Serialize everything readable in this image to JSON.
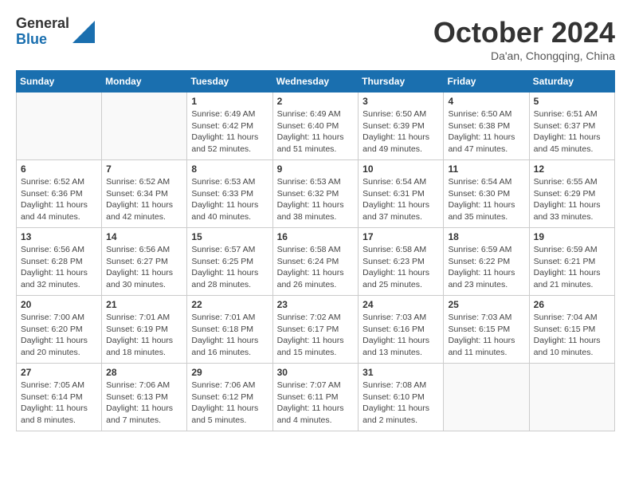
{
  "header": {
    "logo_general": "General",
    "logo_blue": "Blue",
    "month_title": "October 2024",
    "location": "Da'an, Chongqing, China"
  },
  "days_of_week": [
    "Sunday",
    "Monday",
    "Tuesday",
    "Wednesday",
    "Thursday",
    "Friday",
    "Saturday"
  ],
  "weeks": [
    [
      {
        "day": "",
        "info": ""
      },
      {
        "day": "",
        "info": ""
      },
      {
        "day": "1",
        "info": "Sunrise: 6:49 AM\nSunset: 6:42 PM\nDaylight: 11 hours and 52 minutes."
      },
      {
        "day": "2",
        "info": "Sunrise: 6:49 AM\nSunset: 6:40 PM\nDaylight: 11 hours and 51 minutes."
      },
      {
        "day": "3",
        "info": "Sunrise: 6:50 AM\nSunset: 6:39 PM\nDaylight: 11 hours and 49 minutes."
      },
      {
        "day": "4",
        "info": "Sunrise: 6:50 AM\nSunset: 6:38 PM\nDaylight: 11 hours and 47 minutes."
      },
      {
        "day": "5",
        "info": "Sunrise: 6:51 AM\nSunset: 6:37 PM\nDaylight: 11 hours and 45 minutes."
      }
    ],
    [
      {
        "day": "6",
        "info": "Sunrise: 6:52 AM\nSunset: 6:36 PM\nDaylight: 11 hours and 44 minutes."
      },
      {
        "day": "7",
        "info": "Sunrise: 6:52 AM\nSunset: 6:34 PM\nDaylight: 11 hours and 42 minutes."
      },
      {
        "day": "8",
        "info": "Sunrise: 6:53 AM\nSunset: 6:33 PM\nDaylight: 11 hours and 40 minutes."
      },
      {
        "day": "9",
        "info": "Sunrise: 6:53 AM\nSunset: 6:32 PM\nDaylight: 11 hours and 38 minutes."
      },
      {
        "day": "10",
        "info": "Sunrise: 6:54 AM\nSunset: 6:31 PM\nDaylight: 11 hours and 37 minutes."
      },
      {
        "day": "11",
        "info": "Sunrise: 6:54 AM\nSunset: 6:30 PM\nDaylight: 11 hours and 35 minutes."
      },
      {
        "day": "12",
        "info": "Sunrise: 6:55 AM\nSunset: 6:29 PM\nDaylight: 11 hours and 33 minutes."
      }
    ],
    [
      {
        "day": "13",
        "info": "Sunrise: 6:56 AM\nSunset: 6:28 PM\nDaylight: 11 hours and 32 minutes."
      },
      {
        "day": "14",
        "info": "Sunrise: 6:56 AM\nSunset: 6:27 PM\nDaylight: 11 hours and 30 minutes."
      },
      {
        "day": "15",
        "info": "Sunrise: 6:57 AM\nSunset: 6:25 PM\nDaylight: 11 hours and 28 minutes."
      },
      {
        "day": "16",
        "info": "Sunrise: 6:58 AM\nSunset: 6:24 PM\nDaylight: 11 hours and 26 minutes."
      },
      {
        "day": "17",
        "info": "Sunrise: 6:58 AM\nSunset: 6:23 PM\nDaylight: 11 hours and 25 minutes."
      },
      {
        "day": "18",
        "info": "Sunrise: 6:59 AM\nSunset: 6:22 PM\nDaylight: 11 hours and 23 minutes."
      },
      {
        "day": "19",
        "info": "Sunrise: 6:59 AM\nSunset: 6:21 PM\nDaylight: 11 hours and 21 minutes."
      }
    ],
    [
      {
        "day": "20",
        "info": "Sunrise: 7:00 AM\nSunset: 6:20 PM\nDaylight: 11 hours and 20 minutes."
      },
      {
        "day": "21",
        "info": "Sunrise: 7:01 AM\nSunset: 6:19 PM\nDaylight: 11 hours and 18 minutes."
      },
      {
        "day": "22",
        "info": "Sunrise: 7:01 AM\nSunset: 6:18 PM\nDaylight: 11 hours and 16 minutes."
      },
      {
        "day": "23",
        "info": "Sunrise: 7:02 AM\nSunset: 6:17 PM\nDaylight: 11 hours and 15 minutes."
      },
      {
        "day": "24",
        "info": "Sunrise: 7:03 AM\nSunset: 6:16 PM\nDaylight: 11 hours and 13 minutes."
      },
      {
        "day": "25",
        "info": "Sunrise: 7:03 AM\nSunset: 6:15 PM\nDaylight: 11 hours and 11 minutes."
      },
      {
        "day": "26",
        "info": "Sunrise: 7:04 AM\nSunset: 6:15 PM\nDaylight: 11 hours and 10 minutes."
      }
    ],
    [
      {
        "day": "27",
        "info": "Sunrise: 7:05 AM\nSunset: 6:14 PM\nDaylight: 11 hours and 8 minutes."
      },
      {
        "day": "28",
        "info": "Sunrise: 7:06 AM\nSunset: 6:13 PM\nDaylight: 11 hours and 7 minutes."
      },
      {
        "day": "29",
        "info": "Sunrise: 7:06 AM\nSunset: 6:12 PM\nDaylight: 11 hours and 5 minutes."
      },
      {
        "day": "30",
        "info": "Sunrise: 7:07 AM\nSunset: 6:11 PM\nDaylight: 11 hours and 4 minutes."
      },
      {
        "day": "31",
        "info": "Sunrise: 7:08 AM\nSunset: 6:10 PM\nDaylight: 11 hours and 2 minutes."
      },
      {
        "day": "",
        "info": ""
      },
      {
        "day": "",
        "info": ""
      }
    ]
  ]
}
